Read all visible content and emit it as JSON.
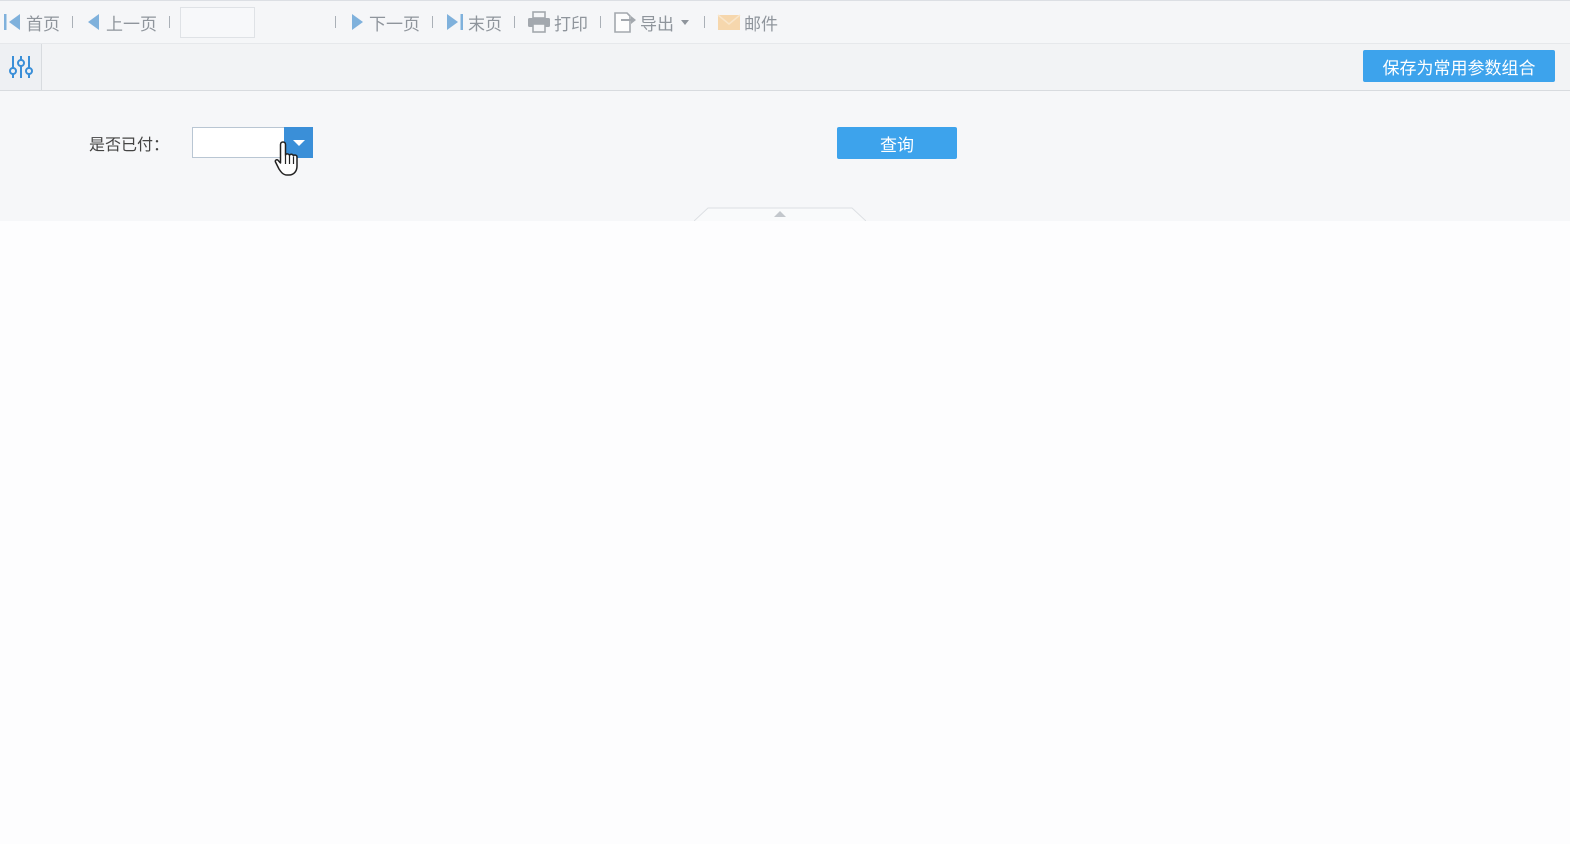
{
  "toolbar": {
    "first": "首页",
    "prev": "上一页",
    "page_value": "",
    "next": "下一页",
    "last": "末页",
    "print": "打印",
    "export": "导出",
    "mail": "邮件"
  },
  "parambar": {
    "save_button": "保存为常用参数组合"
  },
  "query": {
    "paid_label": "是否已付：",
    "paid_value": "",
    "query_button": "查询"
  },
  "colors": {
    "accent": "#3da3ec",
    "combo_button": "#3a8fd8",
    "toolbar_text": "#8f959c"
  },
  "icons": [
    "first-page-icon",
    "prev-page-icon",
    "next-page-icon",
    "last-page-icon",
    "printer-icon",
    "export-icon",
    "mail-icon",
    "sliders-icon",
    "dropdown-arrow-icon",
    "collapse-arrow-icon",
    "hand-cursor-icon"
  ]
}
